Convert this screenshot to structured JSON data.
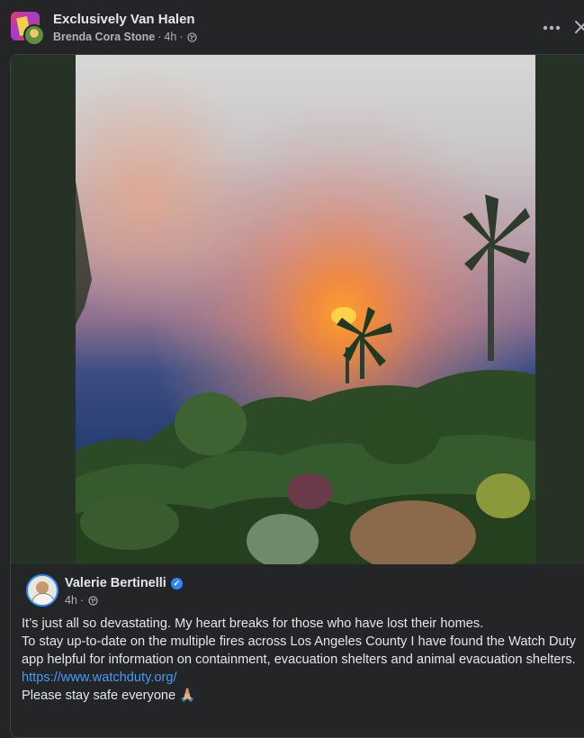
{
  "post": {
    "group_name": "Exclusively Van Halen",
    "poster_name": "Brenda Cora Stone",
    "time": "4h",
    "separator": "·"
  },
  "shared_post": {
    "author": "Valerie Bertinelli",
    "verified_mark": "✓",
    "time": "4h",
    "separator": "·",
    "text_line_1": "It’s just all so devastating. My heart breaks for those who have lost their homes.",
    "text_line_2": "To stay up-to-date on the multiple fires across Los Angeles County I have found the Watch Duty app helpful for information on containment, evacuation shelters and animal evacuation shelters.",
    "link": "https://www.watchduty.org/",
    "text_line_3": "Please stay safe everyone 🙏🏼"
  },
  "icons": {
    "more": "more-options-icon",
    "close": "close-icon",
    "audience": "globe-icon",
    "verified": "verified-badge-icon"
  },
  "colors": {
    "background": "#242526",
    "link": "#4599ff",
    "verified": "#2d88ff",
    "photo_mat": "#273226"
  }
}
